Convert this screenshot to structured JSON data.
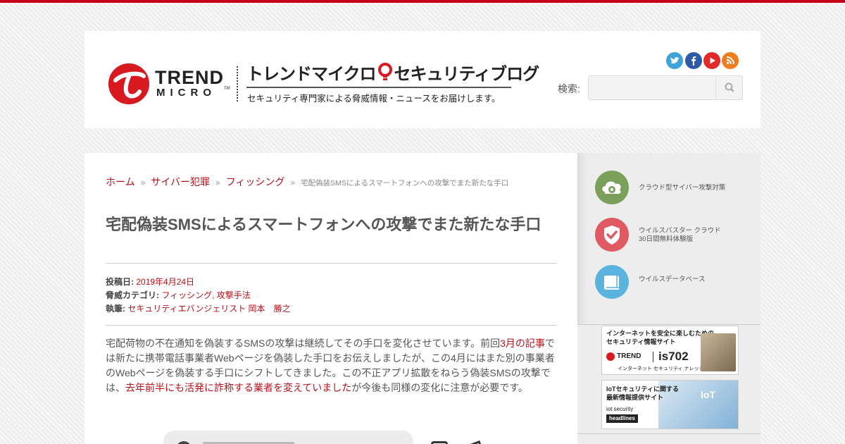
{
  "header": {
    "logo": {
      "line1": "TREND",
      "line2": "MICRO",
      "tm": "TM"
    },
    "blog_title_part1": "トレンドマイクロ",
    "blog_title_part2": "セキュリティブログ",
    "tagline": "セキュリティ専門家による脅威情報・ニュースをお届けします。",
    "social": [
      {
        "icon": "twitter-icon",
        "color": "#3ea3d8"
      },
      {
        "icon": "facebook-icon",
        "color": "#2f5aa8"
      },
      {
        "icon": "youtube-icon",
        "color": "#e02a2a"
      },
      {
        "icon": "rss-icon",
        "color": "#f07d1c"
      }
    ],
    "search": {
      "label": "検索:",
      "value": "",
      "icon": "search-icon"
    }
  },
  "breadcrumb": {
    "home": "ホーム",
    "sep1": "»",
    "category": "サイバー犯罪",
    "sep2": "»",
    "subcategory": "フィッシング",
    "sep3": "»",
    "current": "宅配偽装SMSによるスマートフォンへの攻撃でまた新たな手口"
  },
  "post": {
    "title": "宅配偽装SMSによるスマートフォンへの攻撃でまた新たな手口",
    "meta": {
      "date_label": "投稿日:",
      "date": "2019年4月24日",
      "category_label": "脅威カテゴリ:",
      "category1": "フィッシング",
      "category_sep": ",",
      "category2": "攻撃手法",
      "author_label": "執筆:",
      "author": "セキュリティエバンジェリスト 岡本　勝之"
    },
    "body": {
      "p1_a": "宅配荷物の不在通知を偽装するSMSの攻撃は継続してその手口を変化させています。前回",
      "p1_link1": "3月の記事",
      "p1_b": "では新たに携帯電話事業者Webページを偽装した手口をお伝えしましたが、この4月にはまた別の事業者のWebページを偽装する手口にシフトしてきました。この不正アプリ拡散をねらう偽装SMSの攻撃では、",
      "p1_link2": "去年前半にも活発に詐称する業者を変えていました",
      "p1_c": "が今後も同様の変化に注意が必要です。"
    }
  },
  "sidebar": {
    "items": [
      {
        "icon": "cloud-security-icon",
        "color": "#7ba05b",
        "line1": "クラウド型サイバー攻撃対策",
        "line2": ""
      },
      {
        "icon": "shield-check-icon",
        "color": "#e05a63",
        "line1": "ウイルスバスター クラウド",
        "line2": "30日間無料体験版"
      },
      {
        "icon": "book-icon",
        "color": "#5bb4dd",
        "line1": "ウイルスデータベース",
        "line2": ""
      }
    ],
    "banners": [
      {
        "line1": "インターネットを安全に楽しむための",
        "line2": "セキュリティ情報サイト",
        "brand": "TREND",
        "product": "is702",
        "sub": "インターネット セキュリティ ナレッジ"
      },
      {
        "line1": "IoTセキュリティに関する",
        "line2": "最新情報提供サイト",
        "brand": "iot security",
        "product": "IoT",
        "sub": "headlines"
      }
    ]
  },
  "colors": {
    "accent": "#c8001a",
    "link": "#b5121b",
    "text": "#555555"
  }
}
